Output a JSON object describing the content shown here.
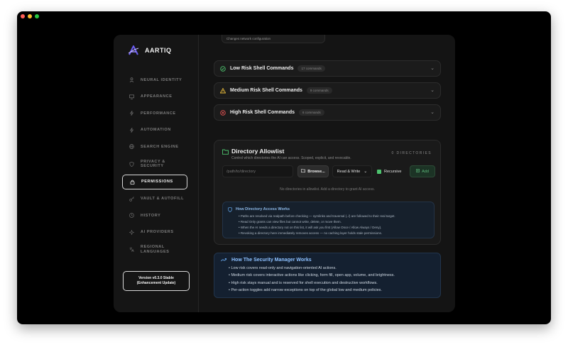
{
  "window": {
    "dots": [
      "#ff5f57",
      "#febc2e",
      "#28c840"
    ]
  },
  "brand": {
    "name": "AARTIQ"
  },
  "sidebar": {
    "items": [
      {
        "label": "NEURAL IDENTITY",
        "icon": "user-icon"
      },
      {
        "label": "APPEARANCE",
        "icon": "monitor-icon"
      },
      {
        "label": "PERFORMANCE",
        "icon": "bolt-icon"
      },
      {
        "label": "AUTOMATION",
        "icon": "bolt-icon"
      },
      {
        "label": "SEARCH ENGINE",
        "icon": "globe-icon"
      },
      {
        "label": "PRIVACY & SECURITY",
        "icon": "shield-icon"
      },
      {
        "label": "PERMISSIONS",
        "icon": "lock-icon",
        "active": true
      },
      {
        "label": "VAULT & AUTOFILL",
        "icon": "key-icon"
      },
      {
        "label": "HISTORY",
        "icon": "history-icon"
      },
      {
        "label": "AI PROVIDERS",
        "icon": "sparkle-icon"
      },
      {
        "label": "REGIONAL LANGUAGES",
        "icon": "language-icon"
      }
    ],
    "version_line1": "Version v0.3.0 Stable",
    "version_line2": "(Enhancement Update)"
  },
  "top_card": {
    "subtitle": "Changes network configuration"
  },
  "accordions": [
    {
      "title": "Low Risk Shell Commands",
      "count": "17 commands",
      "icon": "check-circle-icon",
      "color": "#4dc36e"
    },
    {
      "title": "Medium Risk Shell Commands",
      "count": "9 commands",
      "icon": "warning-icon",
      "color": "#e6b93a"
    },
    {
      "title": "High Risk Shell Commands",
      "count": "6 commands",
      "icon": "x-circle-icon",
      "color": "#e05252"
    }
  ],
  "directory": {
    "title": "Directory Allowlist",
    "description": "Control which directories the AI can access. Scoped, explicit, and revocable.",
    "count": "0 DIRECTORIES",
    "path_placeholder": "/path/to/directory",
    "browse_label": "Browse...",
    "access_mode": "Read & Write",
    "recursive_label": "Recursive",
    "recursive_checked": true,
    "add_label": "Add",
    "empty_text": "No directories in allowlist. Add a directory to grant AI access.",
    "info_title": "How Directory Access Works",
    "info_items": [
      "Paths are resolved via realpath before checking — symlinks and traversal (../) are followed to their real target.",
      "Read Only grants can view files but cannot write, delete, or move them.",
      "When the AI needs a directory not on this list, it will ask you first (Allow Once / Allow Always / Deny).",
      "Revoking a directory here immediately removes access — no caching layer holds stale permissions."
    ]
  },
  "security_manager": {
    "title": "How The Security Manager Works",
    "items": [
      "Low risk covers read-only and navigation-oriented AI actions.",
      "Medium risk covers interactive actions like clicking, form fill, open app, volume, and brightness.",
      "High risk stays manual and is reserved for shell execution and destructive workflows.",
      "Per-action toggles add narrow exceptions on top of the global low and medium policies."
    ]
  }
}
